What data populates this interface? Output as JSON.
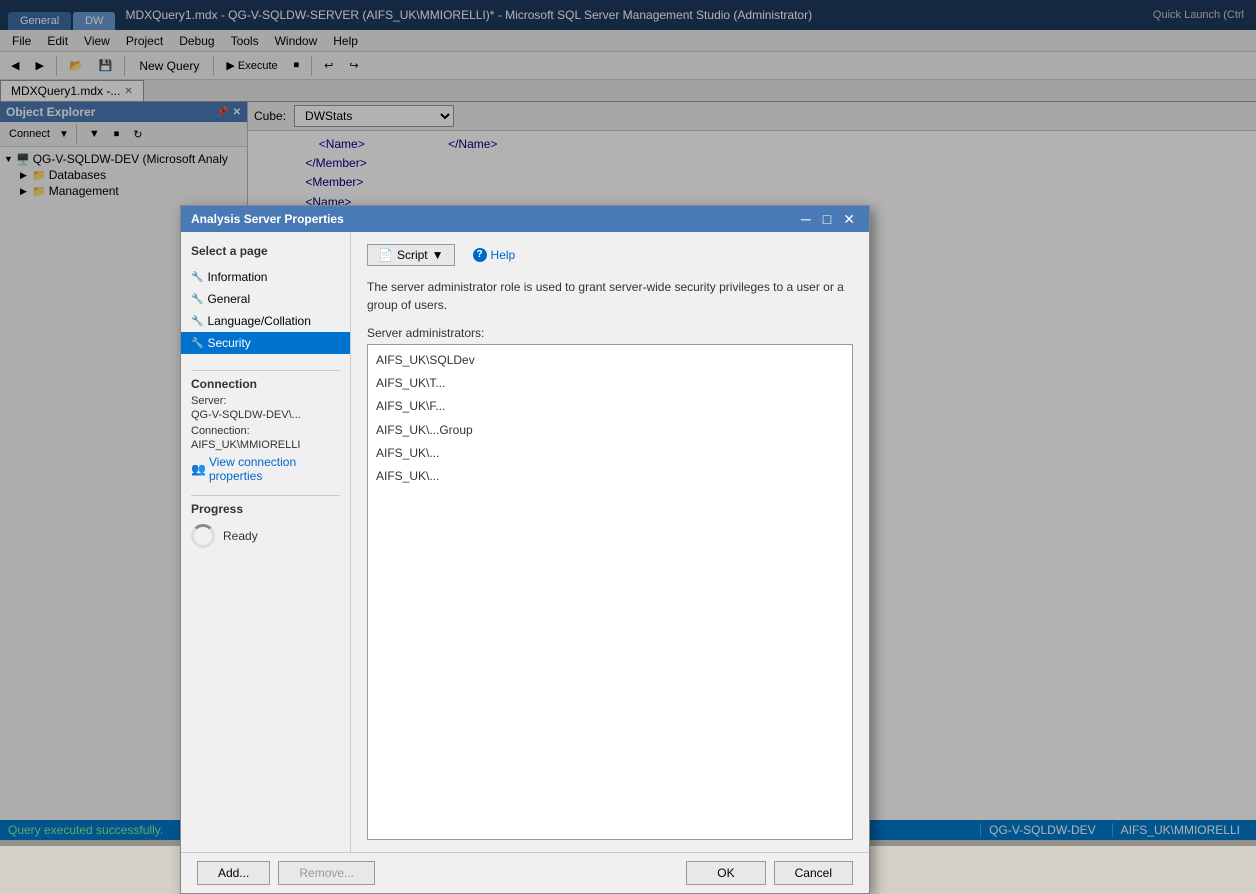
{
  "window": {
    "title": "MDXQuery1.mdx - QG-V-SQLDW-SERVER (AIFS_UK\\MMIORELLI)* - Microsoft SQL Server Management Studio (Administrator)",
    "quick_launch": "Quick Launch (Ctrl",
    "tab_general": "General",
    "tab_dw": "DW"
  },
  "menu": {
    "items": [
      "File",
      "Edit",
      "View",
      "Project",
      "Debug",
      "Tools",
      "Window",
      "Help"
    ]
  },
  "toolbar": {
    "new_query": "New Query"
  },
  "object_explorer": {
    "title": "Object Explorer",
    "connect_btn": "Connect",
    "server_node": "QG-V-SQLDW-DEV (Microsoft Analy",
    "databases_node": "Databases",
    "management_node": "Management"
  },
  "doc_tabs": [
    {
      "label": "MDXQuery1.mdx -...",
      "active": true
    },
    {
      "label": "",
      "active": false
    }
  ],
  "query_editor": {
    "cube_label": "Cube:",
    "cube_value": "DWStats",
    "cube_options": [
      "DWStats"
    ],
    "code_lines": [
      "                    <Name>",
      "                </Member>",
      "                <Member>",
      "                Name>"
    ]
  },
  "dialog": {
    "title": "Analysis Server Properties",
    "pages": {
      "label": "Select a page",
      "items": [
        {
          "label": "Information",
          "selected": false
        },
        {
          "label": "General",
          "selected": false
        },
        {
          "label": "Language/Collation",
          "selected": false
        },
        {
          "label": "Security",
          "selected": true
        }
      ]
    },
    "toolbar": {
      "script_label": "Script",
      "help_label": "Help"
    },
    "content": {
      "description": "The server administrator role is used to grant server-wide security privileges to a user or a group of users.",
      "server_admins_label": "Server administrators:",
      "admins": [
        "AIFS_UK\\SQLDev",
        "AIFS_UK\\T...",
        "AIFS_UK\\F...",
        "AIFS_UK\\...Group",
        "AIFS_UK\\...",
        "AIFS_UK\\..."
      ]
    },
    "connection": {
      "title": "Connection",
      "server_label": "Server:",
      "server_value": "QG-V-SQLDW-DEV\\...",
      "connection_label": "Connection:",
      "connection_value": "AIFS_UK\\MMIORELLI",
      "view_props_label": "View connection properties"
    },
    "progress": {
      "title": "Progress",
      "status": "Ready"
    },
    "buttons": {
      "add": "Add...",
      "remove": "Remove...",
      "ok": "OK",
      "cancel": "Cancel"
    }
  },
  "status_bar": {
    "message": "Query executed successfully.",
    "server": "QG-V-SQLDW-DEV",
    "user": "AIFS_UK\\MMIORELLI"
  }
}
